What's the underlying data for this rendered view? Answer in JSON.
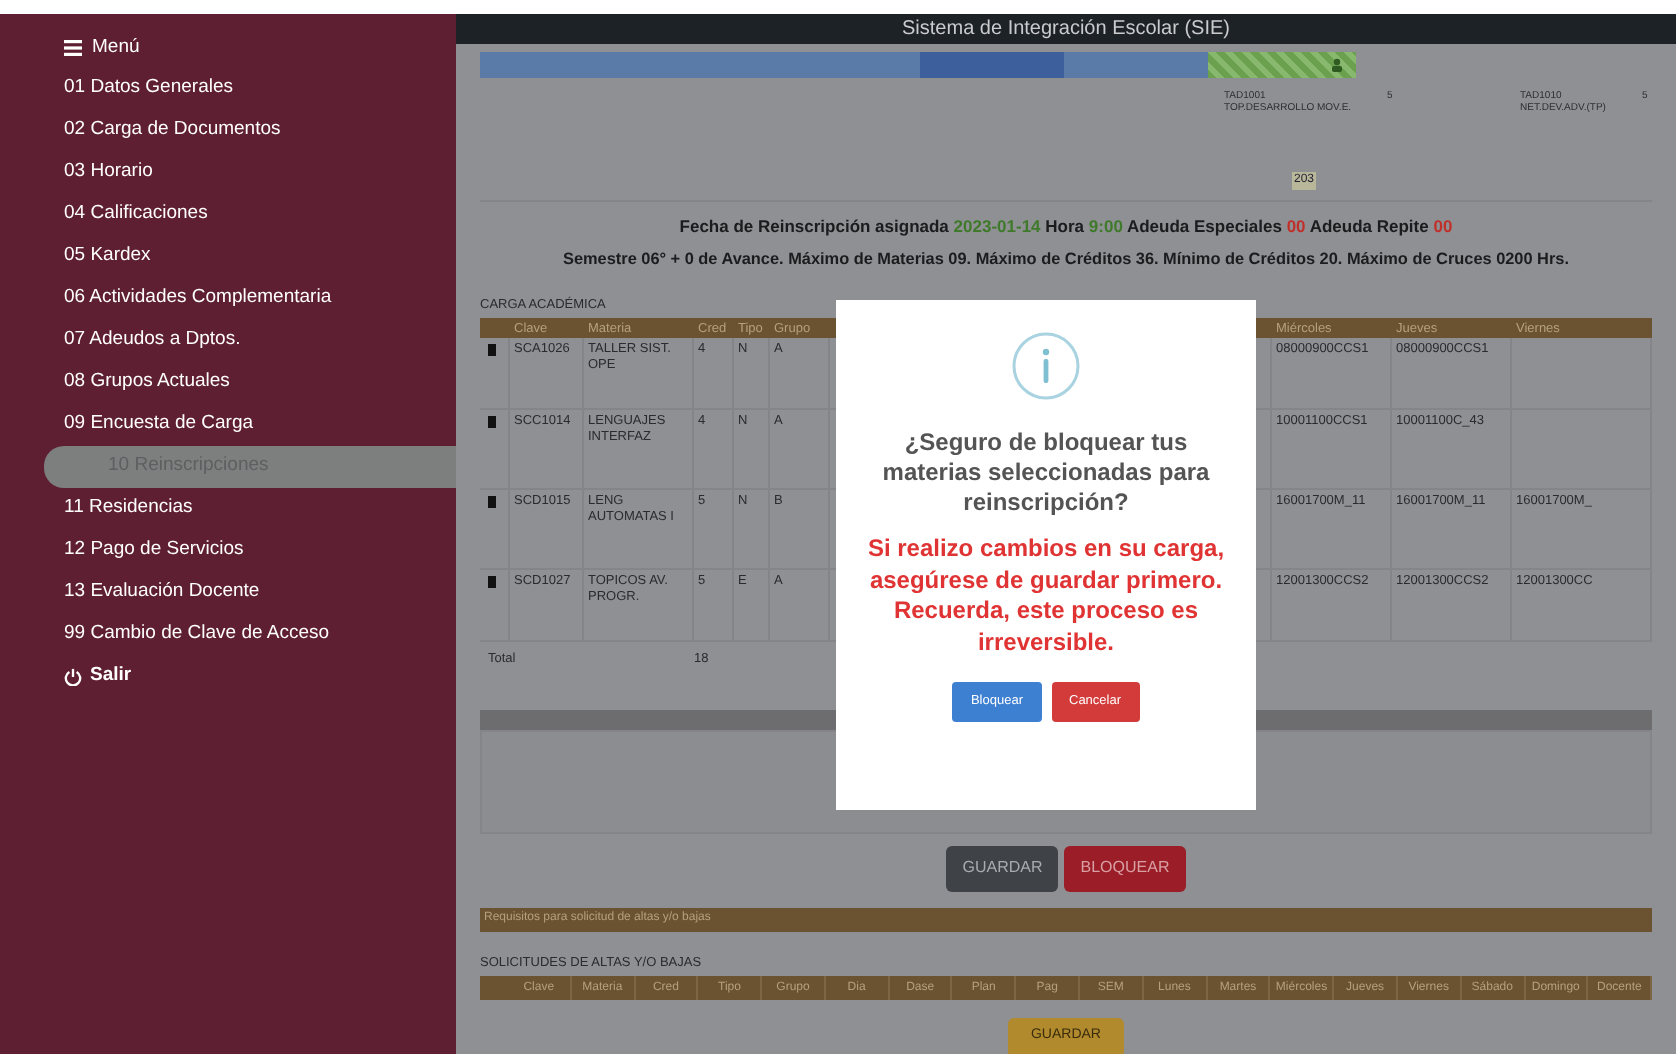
{
  "sidebar": {
    "menu_label": "Menú",
    "items": [
      {
        "label": "01 Datos Generales",
        "selected": false
      },
      {
        "label": "02 Carga de Documentos",
        "selected": false
      },
      {
        "label": "03 Horario",
        "selected": false
      },
      {
        "label": "04 Calificaciones",
        "selected": false
      },
      {
        "label": "05 Kardex",
        "selected": false
      },
      {
        "label": "06 Actividades Complementaria",
        "selected": false
      },
      {
        "label": "07 Adeudos a Dptos.",
        "selected": false
      },
      {
        "label": "08 Grupos Actuales",
        "selected": false
      },
      {
        "label": "09 Encuesta de Carga",
        "selected": false
      },
      {
        "label": "10 Reinscripciones",
        "selected": true
      },
      {
        "label": "11 Residencias",
        "selected": false
      },
      {
        "label": "12 Pago de Servicios",
        "selected": false
      },
      {
        "label": "13 Evaluación Docente",
        "selected": false
      },
      {
        "label": "99 Cambio de Clave de Acceso",
        "selected": false
      }
    ],
    "logout": "Salir"
  },
  "window": {
    "title": "Sistema de Integración Escolar (SIE)"
  },
  "schedule": {
    "courses": [
      {
        "code": "TAD1001",
        "name": "TOP.DESARROLLO MOV.E.",
        "credits": "5"
      },
      {
        "code": "TAD1010",
        "name": "NET.DEV.ADV.(TP)",
        "credits": "5"
      }
    ],
    "room": "203"
  },
  "info": {
    "line1": [
      {
        "text": "Fecha de Reinscripción asignada",
        "kind": "text"
      },
      {
        "text": "2023-01-14",
        "kind": "ok"
      },
      {
        "text": "Hora",
        "kind": "text"
      },
      {
        "text": "9:00",
        "kind": "ok"
      },
      {
        "text": "Adeuda Especiales",
        "kind": "text"
      },
      {
        "text": "00",
        "kind": "alert"
      },
      {
        "text": "Adeuda Repite",
        "kind": "text"
      },
      {
        "text": "00",
        "kind": "alert"
      }
    ],
    "line2": "Semestre 06° + 0 de Avance. Máximo de Materias 09. Máximo de Créditos 36. Mínimo de Créditos 20. Máximo de Cruces 0200 Hrs."
  },
  "load": {
    "title": "CARGA ACADÉMICA",
    "columns": [
      "Clave",
      "Materia",
      "Cred",
      "Tipo",
      "Grupo",
      "Miércoles",
      "Jueves",
      "Viernes"
    ],
    "rows": [
      {
        "cells": [
          "SCA1026",
          "TALLER SIST. OPE",
          "4",
          "N",
          "A",
          "08000900CCS1",
          "08000900CCS1",
          ""
        ]
      },
      {
        "cells": [
          "SCC1014",
          "LENGUAJES INTERFAZ",
          "4",
          "N",
          "A",
          "10001100CCS1",
          "10001100C_43",
          ""
        ]
      },
      {
        "cells": [
          "SCD1015",
          "LENG AUTOMATAS I",
          "5",
          "N",
          "B",
          "16001700M_11",
          "16001700M_11",
          "16001700M_"
        ]
      },
      {
        "cells": [
          "SCD1027",
          "TOPICOS AV. PROGR.",
          "5",
          "E",
          "A",
          "12001300CCS2",
          "12001300CCS2",
          "12001300CC"
        ]
      }
    ],
    "total_label": "Total",
    "total": "18"
  },
  "actions": [
    "GUARDAR",
    "BLOQUEAR"
  ],
  "requirements_bar": "Requisitos para solicitud de altas y/o bajas",
  "requests": {
    "title": "SOLICITUDES DE ALTAS Y/O BAJAS",
    "columns": [
      "Clave",
      "Materia",
      "Cred",
      "Tipo",
      "Grupo",
      "Dia",
      "Dase",
      "Plan",
      "Pag",
      "SEM",
      "Lunes",
      "Martes",
      "Miércoles",
      "Jueves",
      "Viernes",
      "Sábado",
      "Domingo",
      "Docente"
    ],
    "button": "GUARDAR"
  },
  "dialog": {
    "question": "¿Seguro de bloquear tus materias seleccionadas para reinscripción?",
    "warning": "Si realizo cambios en su carga, asegúrese de guardar primero. Recuerda, este proceso es irreversible.",
    "confirm": "Bloquear",
    "cancel": "Cancelar"
  }
}
